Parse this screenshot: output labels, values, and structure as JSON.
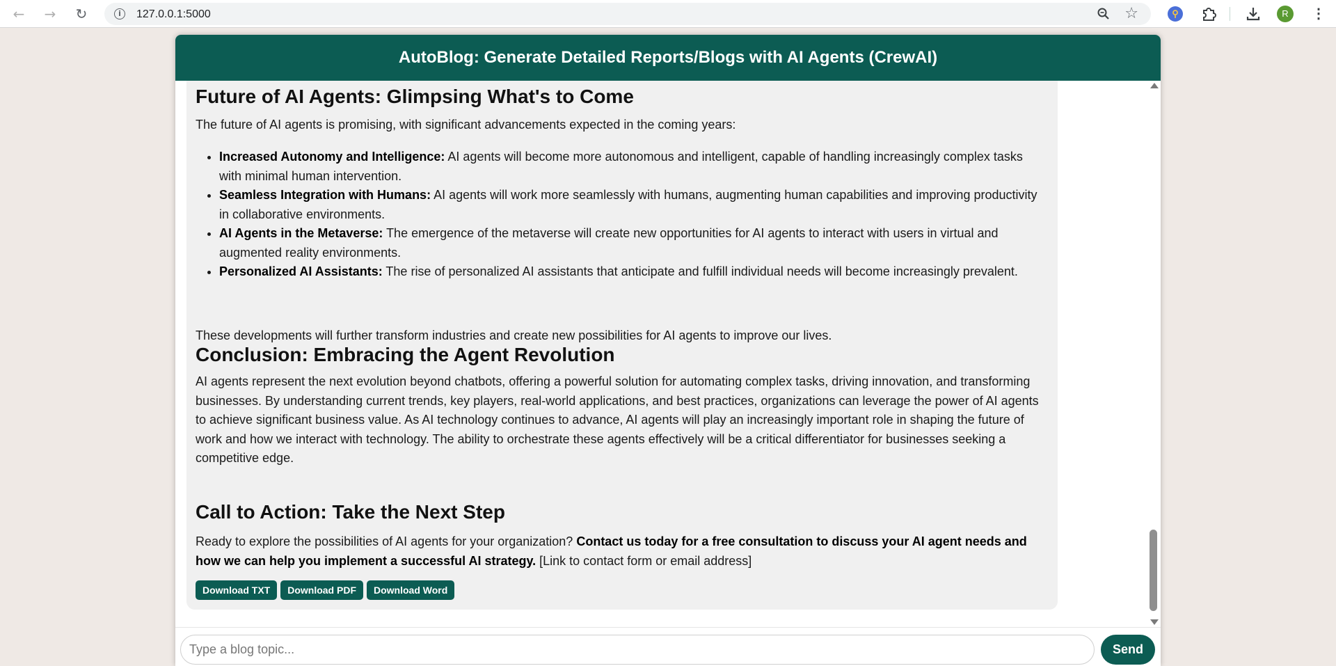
{
  "browser": {
    "url": "127.0.0.1:5000",
    "avatar_letter": "R"
  },
  "app": {
    "title": "AutoBlog: Generate Detailed Reports/Blogs with AI Agents (CrewAI)"
  },
  "article": {
    "section1": {
      "heading": "Future of AI Agents: Glimpsing What's to Come",
      "intro": "The future of AI agents is promising, with significant advancements expected in the coming years:",
      "bullets": [
        {
          "title": "Increased Autonomy and Intelligence:",
          "text": " AI agents will become more autonomous and intelligent, capable of handling increasingly complex tasks with minimal human intervention."
        },
        {
          "title": "Seamless Integration with Humans:",
          "text": " AI agents will work more seamlessly with humans, augmenting human capabilities and improving productivity in collaborative environments."
        },
        {
          "title": "AI Agents in the Metaverse:",
          "text": " The emergence of the metaverse will create new opportunities for AI agents to interact with users in virtual and augmented reality environments."
        },
        {
          "title": "Personalized AI Assistants:",
          "text": " The rise of personalized AI assistants that anticipate and fulfill individual needs will become increasingly prevalent."
        }
      ],
      "outro": "These developments will further transform industries and create new possibilities for AI agents to improve our lives."
    },
    "section2": {
      "heading": "Conclusion: Embracing the Agent Revolution",
      "body": "AI agents represent the next evolution beyond chatbots, offering a powerful solution for automating complex tasks, driving innovation, and transforming businesses. By understanding current trends, key players, real-world applications, and best practices, organizations can leverage the power of AI agents to achieve significant business value. As AI technology continues to advance, AI agents will play an increasingly important role in shaping the future of work and how we interact with technology. The ability to orchestrate these agents effectively will be a critical differentiator for businesses seeking a competitive edge."
    },
    "section3": {
      "heading": "Call to Action: Take the Next Step",
      "lead": "Ready to explore the possibilities of AI agents for your organization? ",
      "bold": "Contact us today for a free consultation to discuss your AI agent needs and how we can help you implement a successful AI strategy.",
      "tail": " [Link to contact form or email address]"
    }
  },
  "downloads": {
    "txt": "Download TXT",
    "pdf": "Download PDF",
    "word": "Download Word"
  },
  "composer": {
    "placeholder": "Type a blog topic...",
    "send_label": "Send"
  },
  "colors": {
    "brand": "#0c5c53",
    "message_bg": "#f0f0f0",
    "page_bg": "#efe9e5"
  }
}
